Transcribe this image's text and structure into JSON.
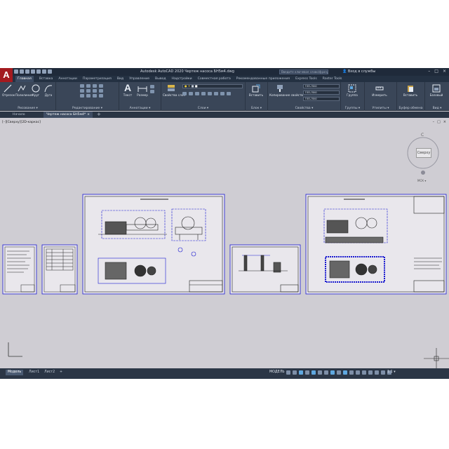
{
  "app": {
    "logo": "A",
    "title": "Autodesk AutoCAD 2020   Чертеж насоса БН5м4.dwg",
    "search_placeholder": "Введите ключевое слово/фразу",
    "login": "Вход в службы",
    "window_controls": [
      "–",
      "□",
      "×"
    ]
  },
  "ribbon_tabs": [
    "Главная",
    "Вставка",
    "Аннотации",
    "Параметризация",
    "Вид",
    "Управление",
    "Вывод",
    "Надстройки",
    "Совместная работа",
    "Рекомендованные приложения",
    "Express Tools",
    "Raster Tools"
  ],
  "active_ribbon_tab": "Главная",
  "ribbon": {
    "draw": {
      "label": "Рисование ▾",
      "tools": [
        "Отрезок",
        "Полилиния",
        "Круг",
        "Дуга"
      ]
    },
    "modify": {
      "label": "Редактирование ▾"
    },
    "annotation": {
      "label": "Аннотации ▾",
      "tools": [
        "Текст",
        "Размер"
      ]
    },
    "layers": {
      "label": "Слои ▾",
      "tools": [
        "Свойства слоя"
      ]
    },
    "block": {
      "label": "Блок ▾",
      "tools": [
        "Вставить"
      ]
    },
    "properties": {
      "label": "Свойства ▾",
      "tools": [
        "Копирование свойств"
      ],
      "combo_values": [
        "ПоСлою",
        "ПоСлою",
        "ПоСлою"
      ]
    },
    "groups": {
      "label": "Группы ▾",
      "tools": [
        "Группа"
      ]
    },
    "utilities": {
      "label": "Утилиты ▾",
      "tools": [
        "Измерить"
      ]
    },
    "clipboard": {
      "label": "Буфер обмена",
      "tools": [
        "Вставить"
      ]
    },
    "view": {
      "label": "Вид ▾",
      "tools": [
        "Базовый"
      ]
    }
  },
  "doc_tabs": [
    "Начало",
    "Чертеж насоса БН5м4*"
  ],
  "viewport": {
    "label": "[–][Сверху][2D-каркас]",
    "controls": [
      "–",
      "□",
      "×"
    ],
    "viewcube": "Сверху",
    "viewcube_n": "С",
    "viewcube_wcs": "МСК ▾"
  },
  "status": {
    "layouts": [
      "Модель",
      "Лист1",
      "Лист2"
    ],
    "active_layout": "Модель",
    "model": "МОДЕЛЬ",
    "scale": "1:1 ▾"
  },
  "colors": {
    "title_bg": "#1f2a3a",
    "ribbon_bg": "#3a4658",
    "canvas_bg": "#cfcdd3",
    "frame_line": "#1a1ad0",
    "logo_red": "#a31a1f"
  }
}
